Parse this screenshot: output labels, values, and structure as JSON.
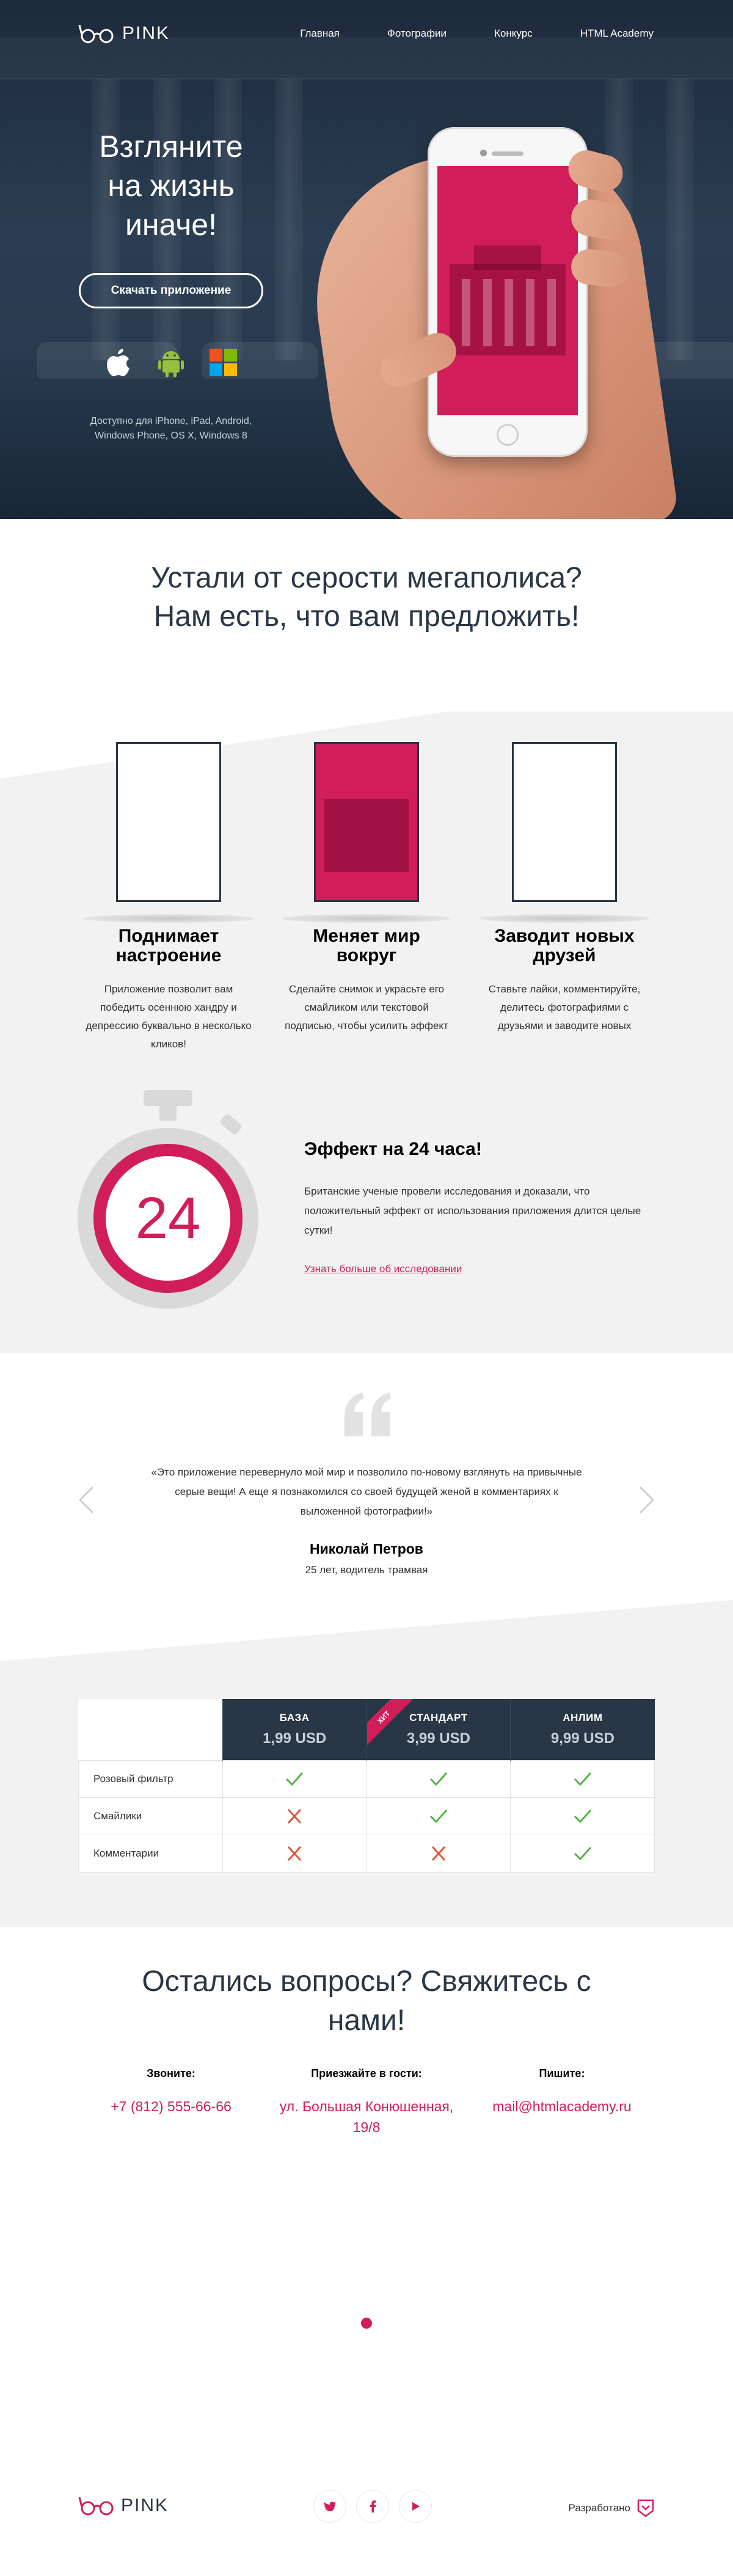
{
  "brand": {
    "name": "PINK",
    "accent": "#d21d5b",
    "dark": "#283645"
  },
  "nav": {
    "items": [
      {
        "label": "Главная"
      },
      {
        "label": "Фотографии"
      },
      {
        "label": "Конкурс"
      },
      {
        "label": "HTML Academy"
      }
    ]
  },
  "hero": {
    "title": "Взгляните на жизнь иначе!",
    "download_label": "Скачать приложение",
    "platform_icons": [
      "apple-icon",
      "android-icon",
      "windows-icon"
    ],
    "note": "Доступно для iPhone, iPad, Android, Windows Phone, OS X, Windows 8"
  },
  "intro": {
    "title": "Устали от серости мегаполиса? Нам есть, что вам предложить!"
  },
  "features": [
    {
      "title": "Поднимает настроение",
      "text": "Приложение позволит вам победить осеннюю хандру и депрессию буквально в несколько кликов!"
    },
    {
      "title": "Меняет мир вокруг",
      "text": "Сделайте снимок и украсьте его смайликом или текстовой подписью, чтобы усилить эффект"
    },
    {
      "title": "Заводит новых друзей",
      "text": "Ставьте лайки, комментируйте, делитесь фотографиями с друзьями и заводите новых"
    }
  ],
  "effect": {
    "timer_value": "24",
    "title": "Эффект на 24 часа!",
    "text": "Британские ученые провели исследования и доказали, что положительный эффект от использования приложения длится целые сутки!",
    "link": "Узнать больше об исследовании"
  },
  "review": {
    "quote": "«Это приложение перевернуло мой мир и позволило по-новому взглянуть на привычные серые вещи! А еще я познакомился со своей будущей женой в комментариях к выложенной фотографии!»",
    "author": "Николай Петров",
    "role": "25 лет, водитель трамвая"
  },
  "pricing": {
    "plans": [
      {
        "name": "БАЗА",
        "price": "1,99 USD"
      },
      {
        "name": "СТАНДАРТ",
        "price": "3,99 USD",
        "badge": "ХИТ"
      },
      {
        "name": "АНЛИМ",
        "price": "9,99 USD"
      }
    ],
    "rows": [
      {
        "feature": "Розовый фильтр",
        "included": [
          true,
          true,
          true
        ]
      },
      {
        "feature": "Смайлики",
        "included": [
          false,
          true,
          true
        ]
      },
      {
        "feature": "Комментарии",
        "included": [
          false,
          false,
          true
        ]
      }
    ]
  },
  "contacts": {
    "title": "Остались вопросы? Свяжитесь с нами!",
    "blocks": [
      {
        "heading": "Звоните:",
        "value": "+7 (812) 555-66-66"
      },
      {
        "heading": "Приезжайте в гости:",
        "value": "ул. Большая Конюшенная, 19/8"
      },
      {
        "heading": "Пишите:",
        "value": "mail@htmlacademy.ru"
      }
    ]
  },
  "footer": {
    "social": [
      "twitter-icon",
      "facebook-icon",
      "youtube-icon"
    ],
    "made_by": "Разработано"
  }
}
